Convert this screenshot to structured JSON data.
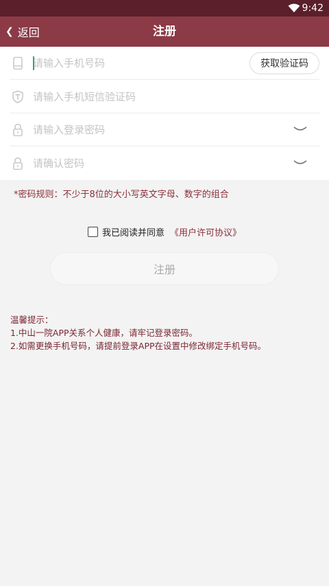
{
  "status_bar": {
    "time": "9:42",
    "wifi_icon": "wifi-icon"
  },
  "header": {
    "back_label": "返回",
    "title": "注册"
  },
  "form": {
    "phone": {
      "placeholder": "请输入手机号码",
      "icon": "phone-icon"
    },
    "get_code_label": "获取验证码",
    "sms_code": {
      "placeholder": "请输入手机短信验证码",
      "icon": "shield-t-icon"
    },
    "password": {
      "placeholder": "请输入登录密码",
      "icon": "lock-icon"
    },
    "confirm_password": {
      "placeholder": "请确认密码",
      "icon": "lock-icon"
    }
  },
  "password_rule": "*密码规则：不少于8位的大小写英文字母、数字的组合",
  "agreement": {
    "checked": false,
    "text": "我已阅读并同意",
    "link": "《用户许可协议》"
  },
  "register_button": "注册",
  "tips": {
    "title": "温馨提示：",
    "line1": "1.中山一院APP关系个人健康，请牢记登录密码。",
    "line2": "2.如需更换手机号码，请提前登录APP在设置中修改绑定手机号码。"
  },
  "colors": {
    "status_bar": "#5a1f2b",
    "header": "#8b3a46",
    "accent": "#8b2f3a",
    "caret": "#2aa198"
  }
}
